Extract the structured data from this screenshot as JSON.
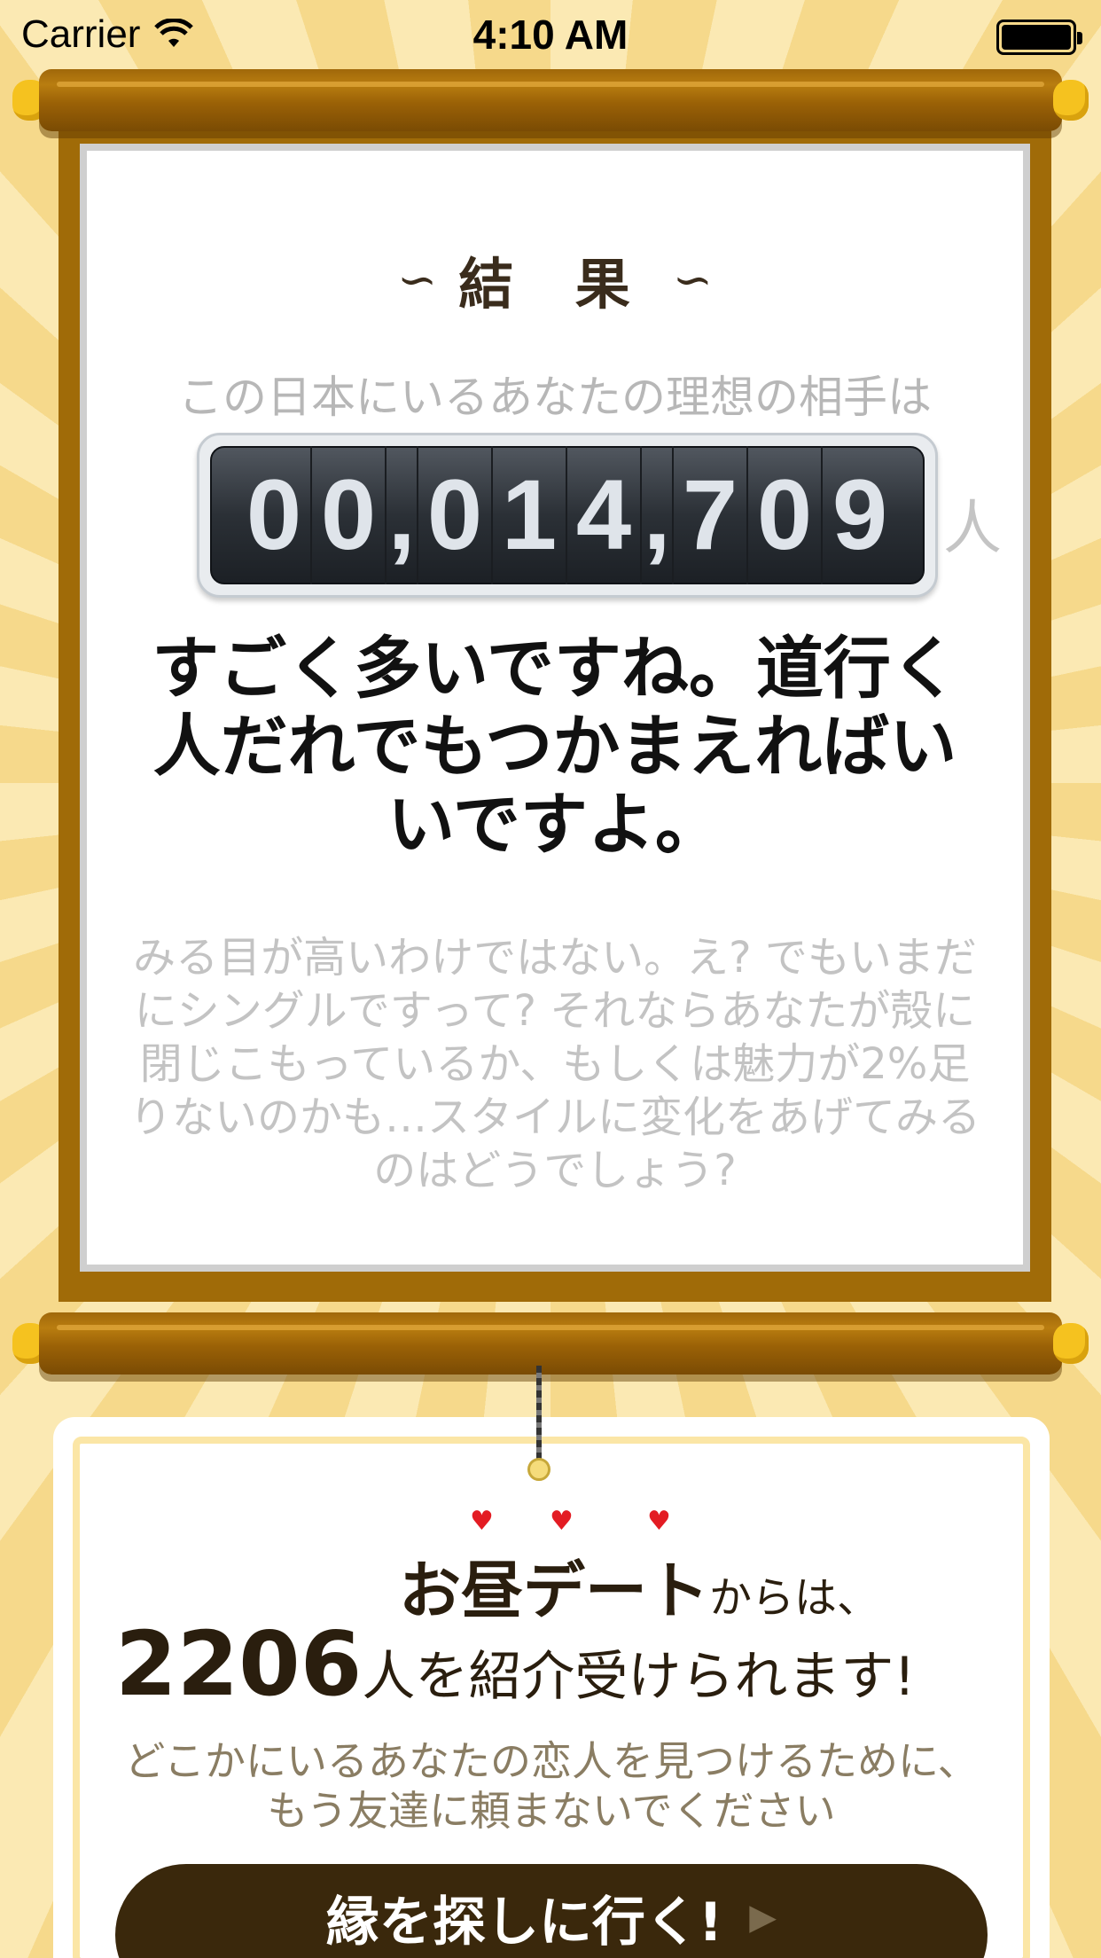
{
  "status_bar": {
    "carrier": "Carrier",
    "time": "4:10 AM",
    "wifi_icon": "wifi-icon",
    "battery_icon": "battery-icon"
  },
  "result": {
    "title": "結 果",
    "subtitle": "この日本にいるあなたの理想の相手は",
    "counter_digits": [
      "0",
      "0",
      ",",
      "0",
      "1",
      "4",
      ",",
      "7",
      "0",
      "9"
    ],
    "counter_value": "00,014,709",
    "unit": "人",
    "message": "すごく多いですね。道行く人だれでもつかまえればいいですよ。",
    "detail": "みる目が高いわけではない。え? でもいまだにシングルですって? それならあなたが殻に閉じこもっているか、もしくは魅力が2%足りないのかも…スタイルに変化をあげてみるのはどうでしょう?"
  },
  "promo": {
    "brand": "お昼デート",
    "brand_suffix": "からは、",
    "count": "2206",
    "count_suffix": "人を紹介受けられます!",
    "pitch_line1": "どこかにいるあなたの恋人を見つけるために、",
    "pitch_line2": "もう友達に頼まないでください",
    "cta_label": "縁を探しに行く!"
  },
  "colors": {
    "background": "#f9e4a4",
    "rod": "#a06b08",
    "knob": "#f5c21f",
    "cta": "#3a280c",
    "heart": "#e31c23"
  }
}
